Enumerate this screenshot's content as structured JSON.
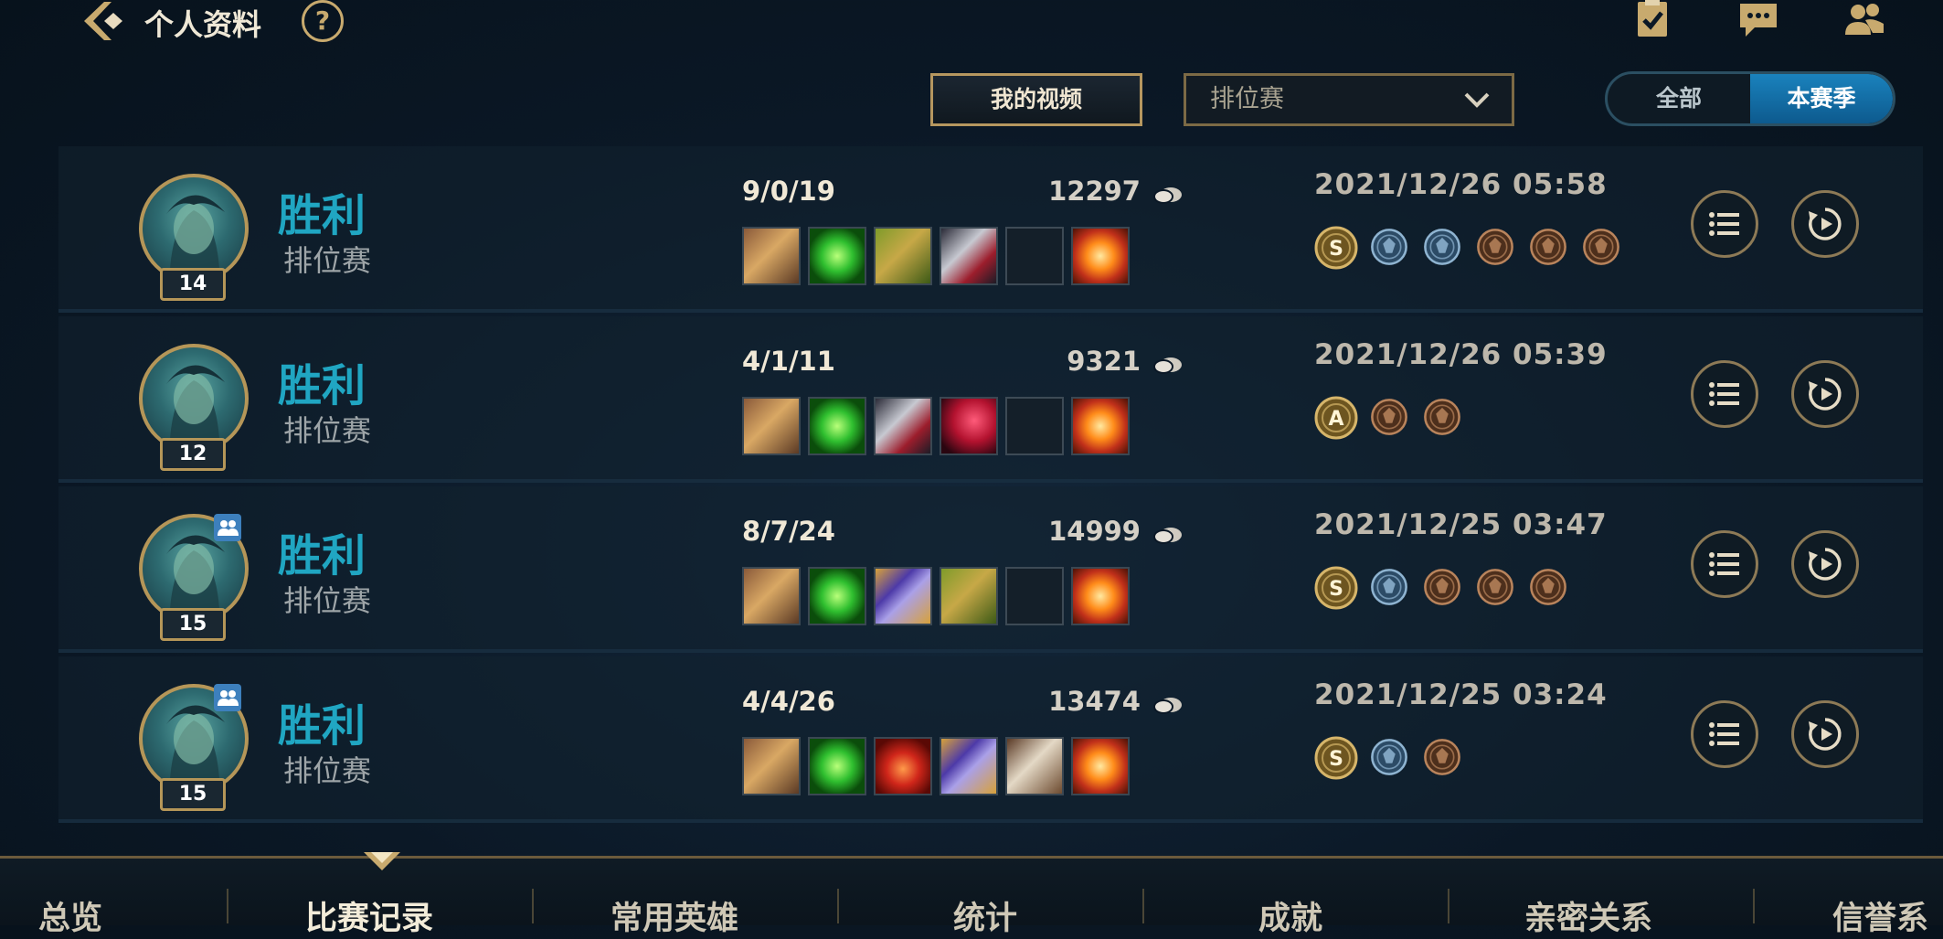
{
  "header": {
    "title": "个人资料",
    "help_label": "?",
    "icons": [
      "back-icon",
      "help-icon",
      "mission-clipboard-icon",
      "chat-icon",
      "friends-icon"
    ]
  },
  "controls": {
    "video_button": "我的视频",
    "mode_select": {
      "value": "排位赛"
    },
    "toggle": {
      "all": "全部",
      "season": "本赛季",
      "selected": "本赛季"
    }
  },
  "matches": [
    {
      "level": "14",
      "result": "胜利",
      "queue": "排位赛",
      "kda": "9/0/19",
      "gold": "12297",
      "date": "2021/12/26 05:58",
      "premade": false,
      "items": [
        "item-gloves",
        "item-green-orb",
        "item-green-armor",
        "item-silver-blade",
        "empty",
        "item-trinket-fire"
      ],
      "badges": [
        "mvp-s-gold",
        "flag-blue",
        "crown-blue",
        "skull-bronze",
        "wings-bronze",
        "shield-bronze"
      ]
    },
    {
      "level": "12",
      "result": "胜利",
      "queue": "排位赛",
      "kda": "4/1/11",
      "gold": "9321",
      "date": "2021/12/26 05:39",
      "premade": false,
      "items": [
        "item-gloves",
        "item-green-orb",
        "item-silver-blade",
        "item-red-crystal",
        "empty",
        "item-trinket-fire"
      ],
      "badges": [
        "mvp-a-gold",
        "skull-bronze",
        "shield-bronze"
      ]
    },
    {
      "level": "15",
      "result": "胜利",
      "queue": "排位赛",
      "kda": "8/7/24",
      "gold": "14999",
      "date": "2021/12/25 03:47",
      "premade": true,
      "items": [
        "item-gloves",
        "item-green-orb",
        "item-purple-rune",
        "item-green-armor",
        "empty",
        "item-trinket-fire"
      ],
      "badges": [
        "mvp-s-gold",
        "flag-blue",
        "shield-bronze",
        "leaf-bronze",
        "drop-bronze"
      ]
    },
    {
      "level": "15",
      "result": "胜利",
      "queue": "排位赛",
      "kda": "4/4/26",
      "gold": "13474",
      "date": "2021/12/25 03:24",
      "premade": true,
      "items": [
        "item-gloves",
        "item-green-orb",
        "item-red-potion",
        "item-purple-rune",
        "item-boots",
        "item-trinket-fire"
      ],
      "badges": [
        "mvp-s-gold",
        "flag-blue",
        "shield-bronze"
      ]
    }
  ],
  "tabs": [
    {
      "label": "总览",
      "active": false
    },
    {
      "label": "比赛记录",
      "active": true
    },
    {
      "label": "常用英雄",
      "active": false
    },
    {
      "label": "统计",
      "active": false
    },
    {
      "label": "成就",
      "active": false
    },
    {
      "label": "亲密关系",
      "active": false
    },
    {
      "label": "信誉系",
      "active": false
    }
  ],
  "colors": {
    "accent_gold": "#c8aa6e",
    "victory": "#20a6c2",
    "selected_blue": "#1a82bd"
  }
}
